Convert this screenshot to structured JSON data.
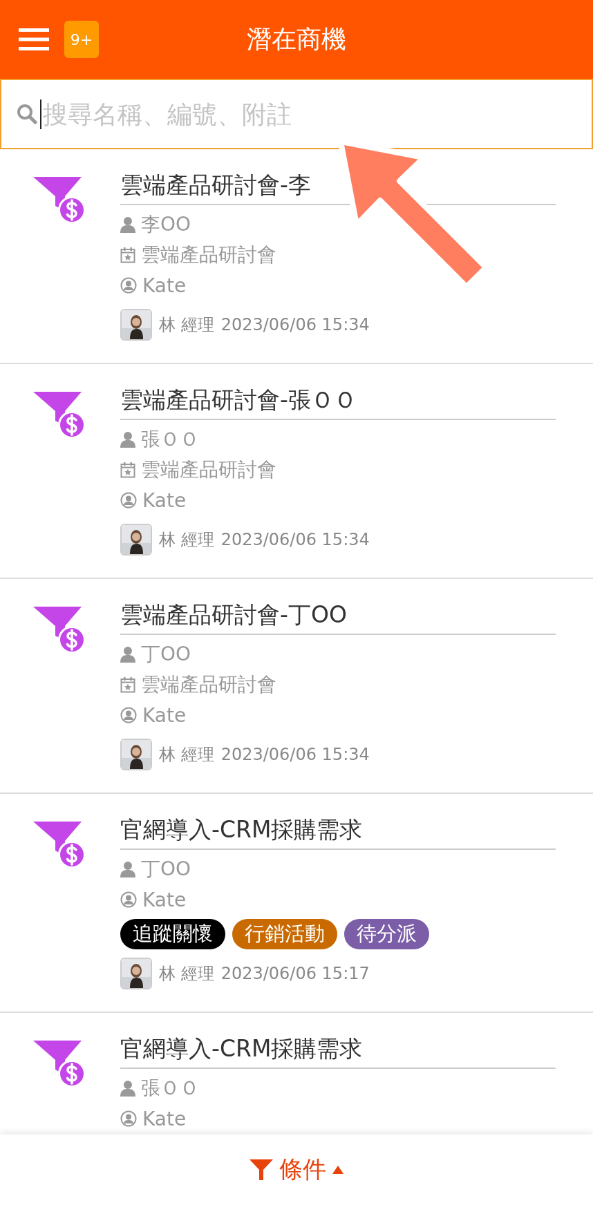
{
  "header": {
    "title": "潛在商機",
    "badge": "9+"
  },
  "search": {
    "placeholder": "搜尋名稱、編號、附註"
  },
  "items": [
    {
      "title": "雲端產品研討會-李",
      "rows": [
        {
          "kind": "contact",
          "text": "李OO"
        },
        {
          "kind": "event",
          "text": "雲端產品研討會"
        },
        {
          "kind": "owner",
          "text": "Kate"
        }
      ],
      "creator": "林 經理",
      "time": "2023/06/06 15:34"
    },
    {
      "title": "雲端產品研討會-張ＯＯ",
      "rows": [
        {
          "kind": "contact",
          "text": "張ＯＯ"
        },
        {
          "kind": "event",
          "text": "雲端產品研討會"
        },
        {
          "kind": "owner",
          "text": "Kate"
        }
      ],
      "creator": "林 經理",
      "time": "2023/06/06 15:34"
    },
    {
      "title": "雲端產品研討會-丁OO",
      "rows": [
        {
          "kind": "contact",
          "text": "丁OO"
        },
        {
          "kind": "event",
          "text": "雲端產品研討會"
        },
        {
          "kind": "owner",
          "text": "Kate"
        }
      ],
      "creator": "林 經理",
      "time": "2023/06/06 15:34"
    },
    {
      "title": "官網導入-CRM採購需求",
      "rows": [
        {
          "kind": "contact",
          "text": "丁OO"
        },
        {
          "kind": "owner",
          "text": "Kate"
        }
      ],
      "tags": [
        {
          "label": "追蹤關懷",
          "color": "#000000"
        },
        {
          "label": "行銷活動",
          "color": "#c96a00"
        },
        {
          "label": "待分派",
          "color": "#7b5ea7"
        }
      ],
      "creator": "林 經理",
      "time": "2023/06/06 15:17"
    },
    {
      "title": "官網導入-CRM採購需求",
      "rows": [
        {
          "kind": "contact",
          "text": "張ＯＯ"
        },
        {
          "kind": "owner",
          "text": "Kate"
        }
      ]
    }
  ],
  "footer": {
    "label": "條件"
  }
}
